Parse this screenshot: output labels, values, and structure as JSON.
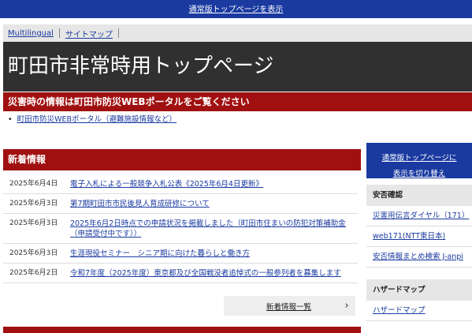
{
  "topbar": {
    "link": "通常版トップページを表示"
  },
  "nav": {
    "items": [
      "Multilingual",
      "サイトマップ"
    ]
  },
  "page": {
    "title": "町田市非常時用トップページ"
  },
  "disaster": {
    "heading": "災害時の情報は町田市防災WEBポータルをご覧ください",
    "bullet": "•",
    "link": "町田市防災WEBポータル（避難施設情報など）"
  },
  "news": {
    "heading": "新着情報",
    "items": [
      {
        "date": "2025年6月4日",
        "title": "電子入札による一般競争入札公表《2025年6月4日更新》"
      },
      {
        "date": "2025年6月3日",
        "title": "第7期町田市市民後見人育成研修について"
      },
      {
        "date": "2025年6月3日",
        "title": "2025年6月2日時点での申請状況を掲載しました（町田市住まいの防犯対策補助金（申請受付中です））"
      },
      {
        "date": "2025年6月3日",
        "title": "生涯現役セミナー　シニア期に向けた暮らしと働き方"
      },
      {
        "date": "2025年6月2日",
        "title": "令和7年度（2025年度）東京都及び全国戦没者追悼式の一般参列者を募集します"
      }
    ],
    "more_label": "新着情報一覧",
    "more_icon": "chevron-right-icon",
    "more_glyph": "›"
  },
  "sidebar": {
    "normal_top": {
      "line1": "通常版トップページに",
      "line2": "表示を切り替え"
    },
    "safety": {
      "heading": "安否確認",
      "links": [
        "災害用伝言ダイヤル（171）",
        "web171(NTT東日本)",
        "安否情報まとめ検索 J-anpi"
      ]
    },
    "hazard": {
      "heading": "ハザードマップ",
      "links": [
        "ハザードマップ"
      ]
    }
  },
  "colors": {
    "blue": "#1a3aa0",
    "red": "#a01010",
    "dark": "#303030",
    "gray": "#e6e6e6"
  }
}
